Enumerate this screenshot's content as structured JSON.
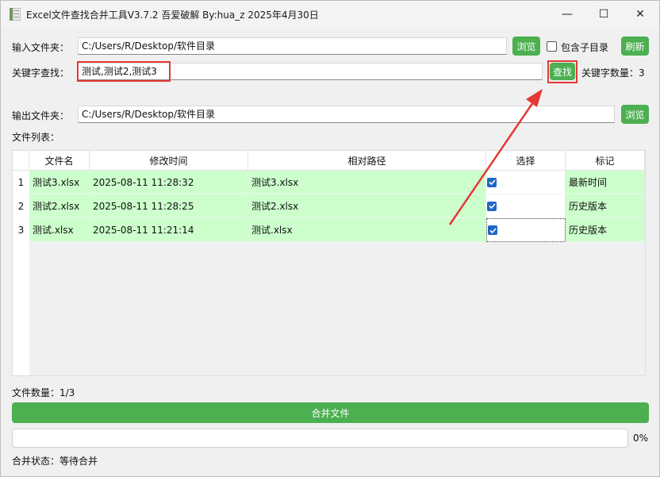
{
  "window": {
    "title": "Excel文件查找合并工具V3.7.2 吾爱破解 By:hua_z 2025年4月30日",
    "minimize_glyph": "—",
    "maximize_glyph": "☐",
    "close_glyph": "✕"
  },
  "input_folder": {
    "label": "输入文件夹：",
    "value": "C:/Users/R/Desktop/软件目录",
    "browse_label": "浏览",
    "include_sub_label": "包含子目录",
    "include_sub_checked": false,
    "refresh_label": "刷新"
  },
  "keyword": {
    "label": "关键字查找：",
    "value": "测试,测试2,测试3",
    "search_label": "查找",
    "count_label": "关键字数量：3"
  },
  "output_folder": {
    "label": "输出文件夹：",
    "value": "C:/Users/R/Desktop/软件目录",
    "browse_label": "浏览"
  },
  "file_list": {
    "label": "文件列表：",
    "columns": [
      "文件名",
      "修改时间",
      "相对路径",
      "选择",
      "标记"
    ],
    "rows": [
      {
        "num": "1",
        "name": "测试3.xlsx",
        "time": "2025-08-11 11:28:32",
        "path": "测试3.xlsx",
        "selected": true,
        "tag": "最新时间"
      },
      {
        "num": "2",
        "name": "测试2.xlsx",
        "time": "2025-08-11 11:28:25",
        "path": "测试2.xlsx",
        "selected": true,
        "tag": "历史版本"
      },
      {
        "num": "3",
        "name": "测试.xlsx",
        "time": "2025-08-11 11:21:14",
        "path": "测试.xlsx",
        "selected": true,
        "tag": "历史版本"
      }
    ]
  },
  "file_count": "文件数量：1/3",
  "merge_button": "合并文件",
  "progress": {
    "value": 0,
    "label": "0%"
  },
  "merge_status": "合并状态：等待合并",
  "colors": {
    "accent_green": "#4caf50",
    "row_green": "#ccffcc",
    "highlight_red": "#e53935",
    "checkbox_blue": "#1f67c5"
  }
}
